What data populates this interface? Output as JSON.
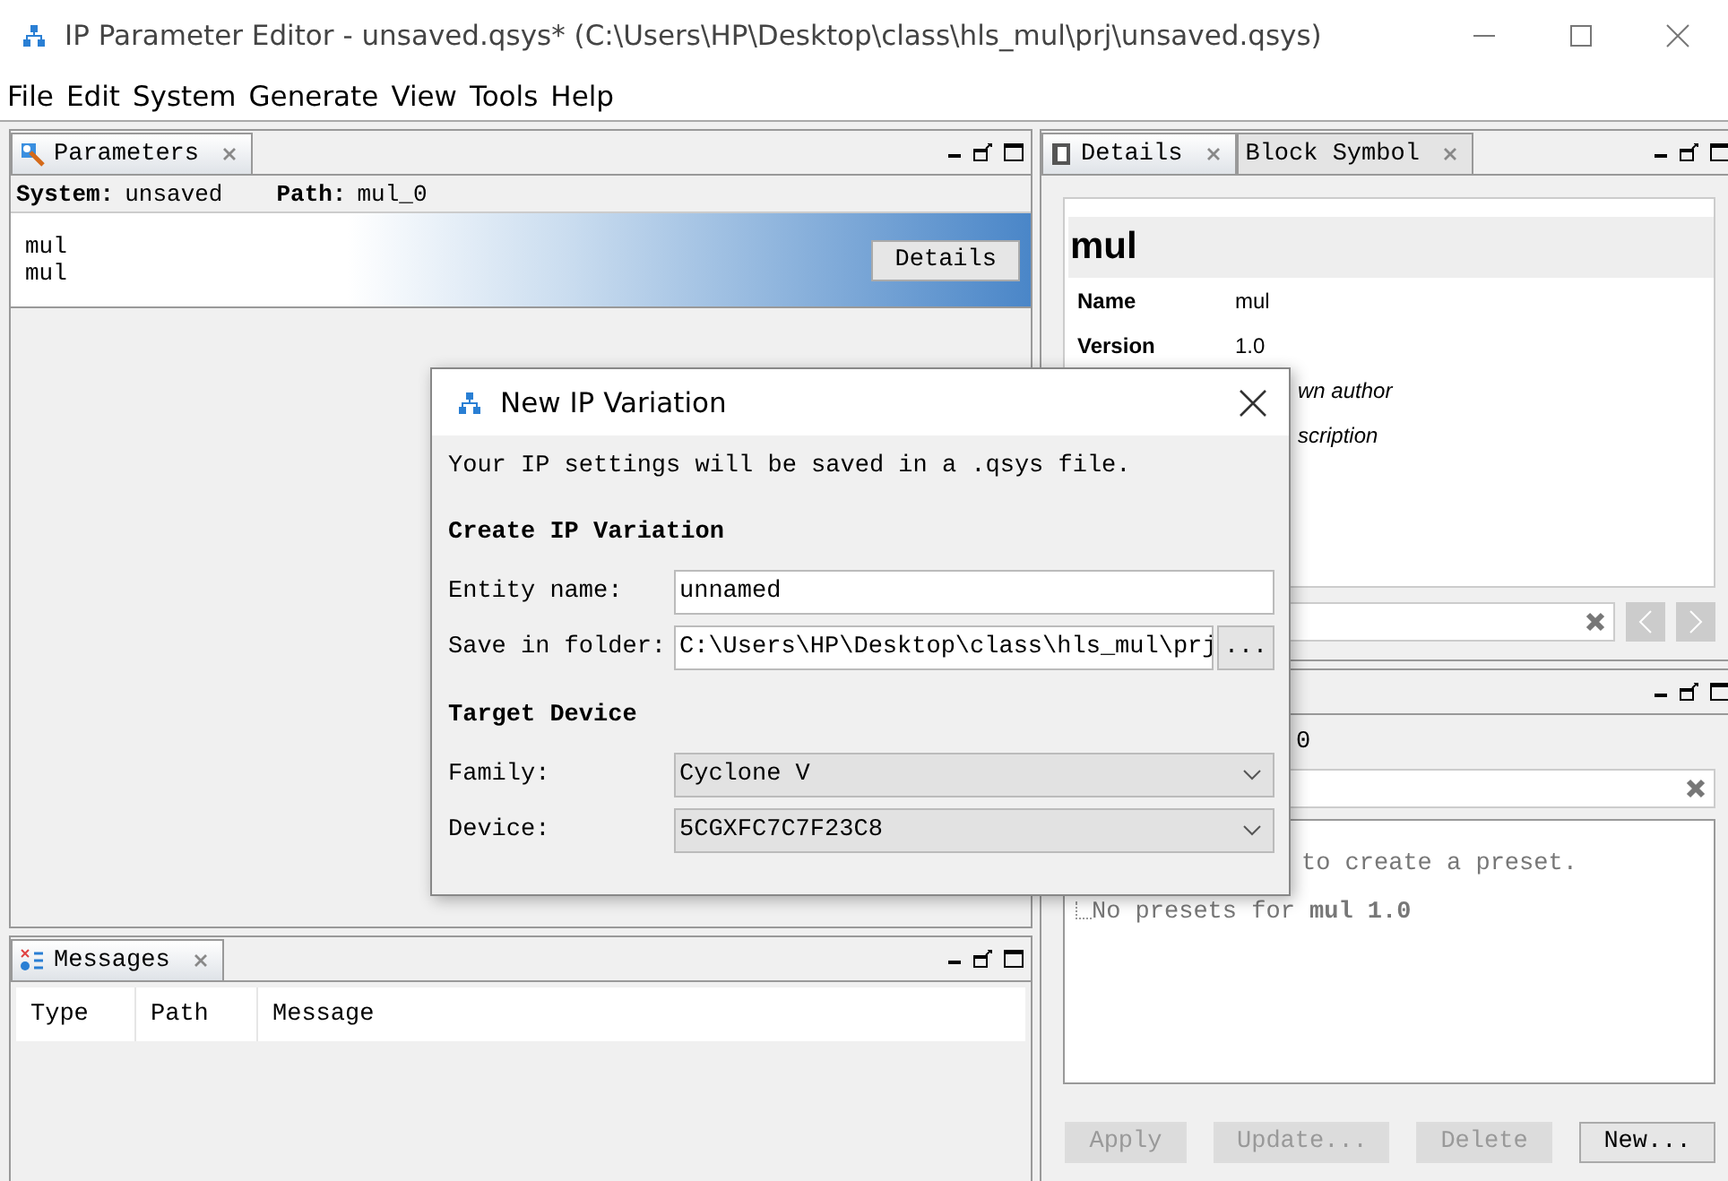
{
  "window": {
    "title": "IP Parameter Editor - unsaved.qsys* (C:\\Users\\HP\\Desktop\\class\\hls_mul\\prj\\unsaved.qsys)"
  },
  "menu": [
    "File",
    "Edit",
    "System",
    "Generate",
    "View",
    "Tools",
    "Help"
  ],
  "parameters_panel": {
    "tab": "Parameters",
    "system_label": "System:",
    "system_value": "unsaved",
    "path_label": "Path:",
    "path_value": "mul_0",
    "header_lines": [
      "mul",
      "mul"
    ],
    "details_button": "Details"
  },
  "messages_panel": {
    "tab": "Messages",
    "columns": [
      "Type",
      "Path",
      "Message"
    ]
  },
  "details_panel": {
    "tabs": [
      {
        "label": "Details",
        "selected": true
      },
      {
        "label": "Block Symbol",
        "selected": false
      }
    ],
    "heading": "mul",
    "fields": [
      {
        "label": "Name",
        "value": "mul"
      },
      {
        "label": "Version",
        "value": "1.0"
      }
    ],
    "notes": [
      "wn author",
      "scription"
    ]
  },
  "presets_panel": {
    "header_fragment": "0",
    "hint_fragment": "to create a preset.",
    "empty_text": "No presets for **mul 1.0**",
    "buttons": [
      {
        "label": "Apply",
        "disabled": true
      },
      {
        "label": "Update...",
        "disabled": true
      },
      {
        "label": "Delete",
        "disabled": true
      },
      {
        "label": "New...",
        "disabled": false
      }
    ]
  },
  "dialog": {
    "title": "New IP Variation",
    "intro": "Your IP settings will be saved in a .qsys file.",
    "sections": [
      {
        "heading": "Create IP Variation",
        "fields": [
          {
            "kind": "text",
            "label": "Entity name:",
            "value": "unnamed"
          },
          {
            "kind": "folder",
            "label": "Save in folder:",
            "value": "C:\\Users\\HP\\Desktop\\class\\hls_mul\\prj",
            "button": "..."
          }
        ]
      },
      {
        "heading": "Target Device",
        "fields": [
          {
            "kind": "dropdown",
            "label": "Family:",
            "value": "Cyclone V"
          },
          {
            "kind": "dropdown",
            "label": "Device:",
            "value": "5CGXFC7C7F23C8"
          }
        ]
      }
    ]
  }
}
